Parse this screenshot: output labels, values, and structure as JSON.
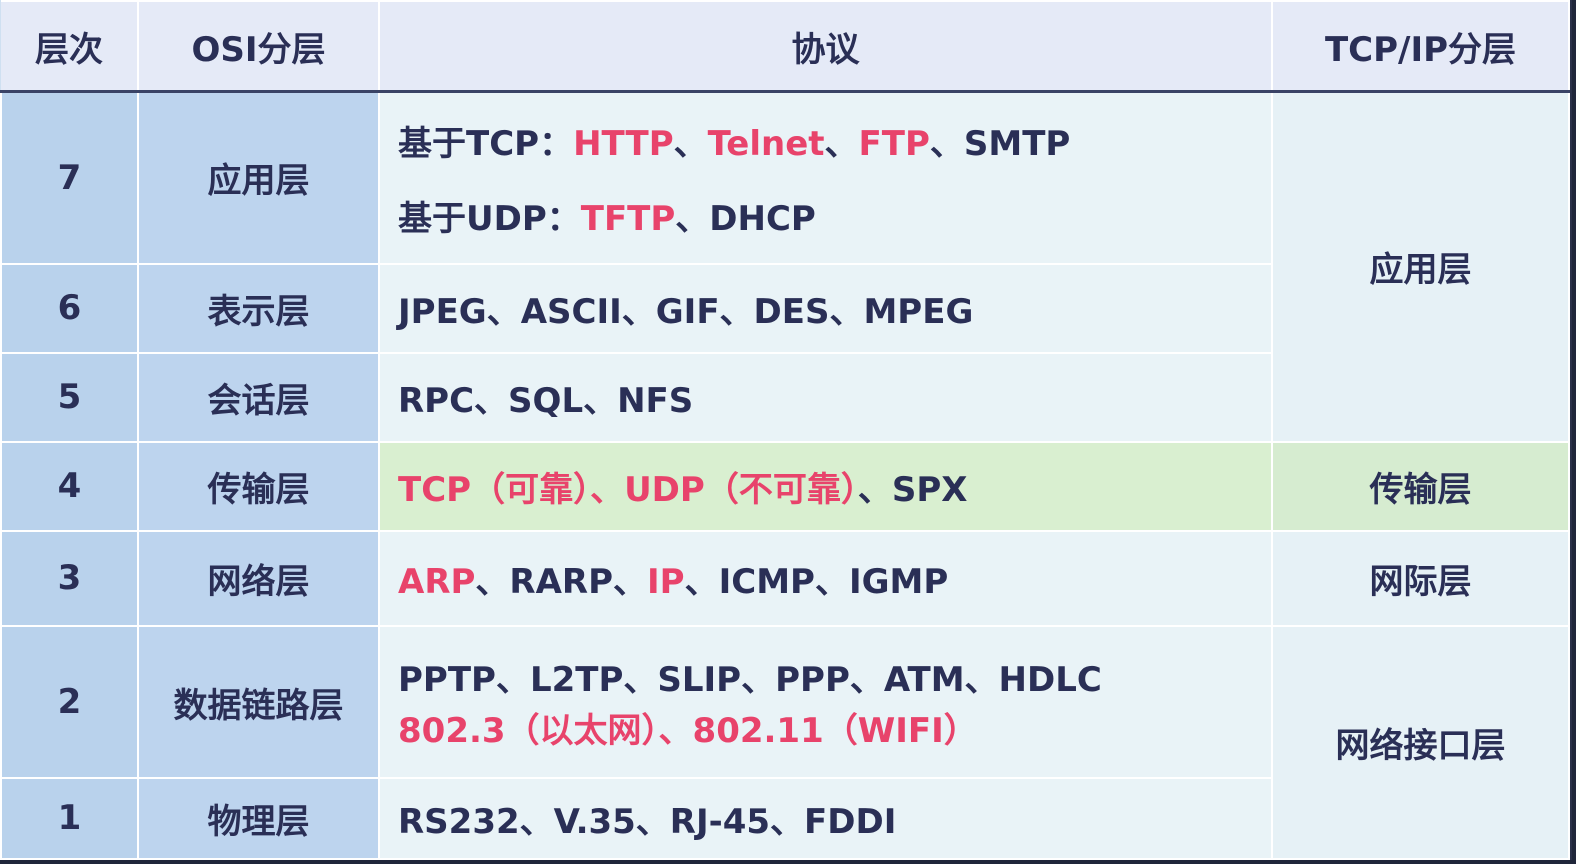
{
  "header": {
    "level": "层次",
    "osi": "OSI分层",
    "protocols": "协议",
    "tcpip": "TCP/IP分层"
  },
  "rows": {
    "r7": {
      "level": "7",
      "osi": "应用层",
      "line1": [
        {
          "t": "基于TCP：",
          "hl": false
        },
        {
          "t": "HTTP",
          "hl": true
        },
        {
          "t": "、",
          "hl": false
        },
        {
          "t": "Telnet",
          "hl": true
        },
        {
          "t": "、",
          "hl": false
        },
        {
          "t": "FTP",
          "hl": true
        },
        {
          "t": "、SMTP",
          "hl": false
        }
      ],
      "line2": [
        {
          "t": "基于UDP：",
          "hl": false
        },
        {
          "t": "TFTP",
          "hl": true
        },
        {
          "t": "、DHCP",
          "hl": false
        }
      ]
    },
    "r6": {
      "level": "6",
      "osi": "表示层",
      "line1": [
        {
          "t": "JPEG、ASCII、GIF、DES、MPEG",
          "hl": false
        }
      ]
    },
    "r5": {
      "level": "5",
      "osi": "会话层",
      "line1": [
        {
          "t": "RPC、SQL、NFS",
          "hl": false
        }
      ]
    },
    "r4": {
      "level": "4",
      "osi": "传输层",
      "line1": [
        {
          "t": "TCP（可靠）、UDP（不可靠）",
          "hl": true
        },
        {
          "t": "、SPX",
          "hl": false
        }
      ]
    },
    "r3": {
      "level": "3",
      "osi": "网络层",
      "line1": [
        {
          "t": "ARP",
          "hl": true
        },
        {
          "t": "、RARP、",
          "hl": false
        },
        {
          "t": "IP",
          "hl": true
        },
        {
          "t": "、ICMP、IGMP",
          "hl": false
        }
      ]
    },
    "r2": {
      "level": "2",
      "osi": "数据链路层",
      "line1": [
        {
          "t": "PPTP、L2TP、SLIP、PPP、ATM、HDLC",
          "hl": false
        }
      ],
      "line2": [
        {
          "t": "802.3（以太网）、802.11（WIFI）",
          "hl": true
        }
      ]
    },
    "r1": {
      "level": "1",
      "osi": "物理层",
      "line1": [
        {
          "t": "RS232、V.35、RJ-45、FDDI",
          "hl": false
        }
      ]
    }
  },
  "tcpip": {
    "application": "应用层",
    "transport": "传输层",
    "internet": "网际层",
    "network_interface": "网络接口层"
  },
  "colors": {
    "highlight": "#e8436b",
    "text": "#2a2f56",
    "osi_column_bg": "#bdd4ee",
    "transport_row_bg": "#d9efd0"
  }
}
